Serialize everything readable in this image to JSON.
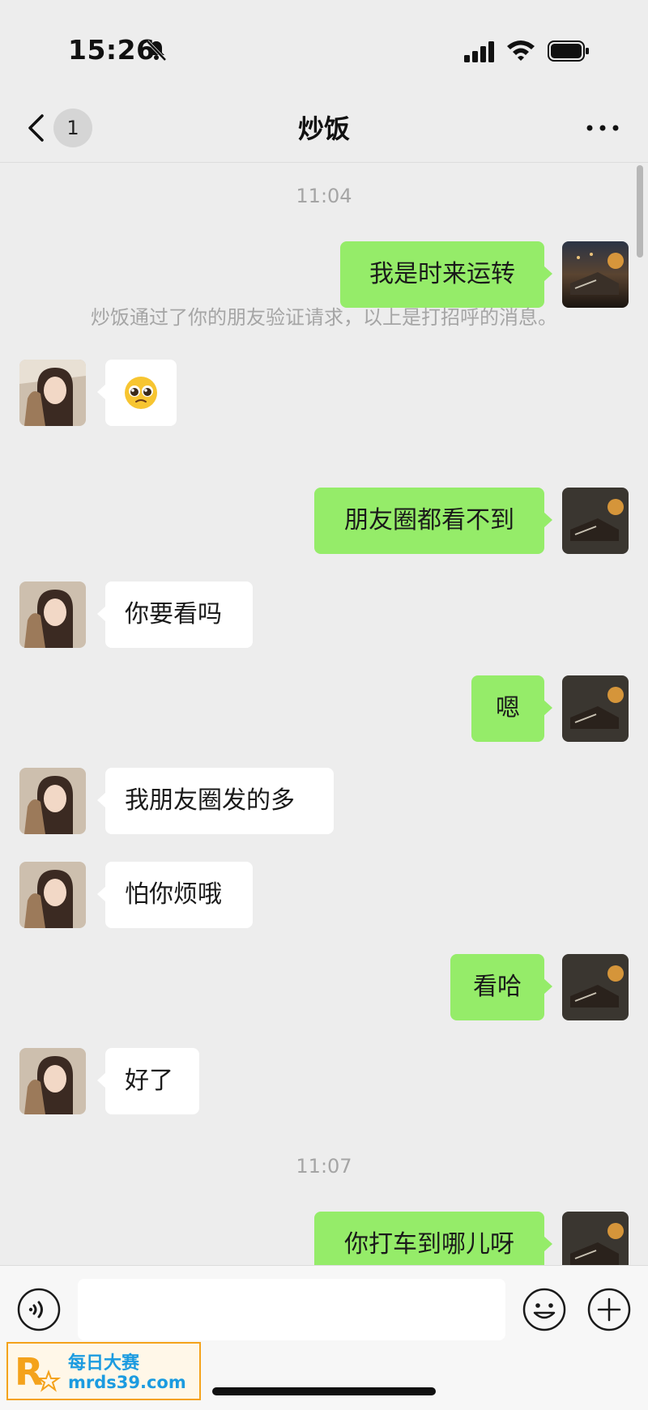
{
  "status_bar": {
    "time": "15:26"
  },
  "nav": {
    "unread_count": "1",
    "title": "炒饭"
  },
  "messages": {
    "time_1": "11:04",
    "system_notice": "炒饭通过了你的朋友验证请求，以上是打招呼的消息。",
    "m1": "我是时来运转",
    "m3": "朋友圈都看不到",
    "m4": "你要看吗",
    "m5": "嗯",
    "m6": "我朋友圈发的多",
    "m7": "怕你烦哦",
    "m8": "看哈",
    "m9": "好了",
    "time_2": "11:07",
    "m10": "你打车到哪儿呀"
  },
  "watermark": {
    "title": "每日大赛",
    "url": "mrds39.com"
  },
  "colors": {
    "my_bubble": "#95ec69",
    "their_bubble": "#ffffff",
    "background": "#ededed"
  }
}
